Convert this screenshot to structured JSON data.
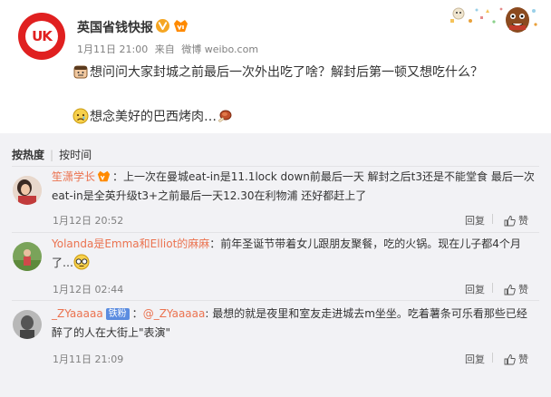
{
  "post": {
    "author": "英国省钱快报",
    "date": "1月11日 21:00",
    "source_prefix": "来自",
    "source": "微博 weibo.com",
    "line1": "想问问大家封城之前最后一次外出吃了啥？解封后第一顿又想吃什么？",
    "line2": "想念美好的巴西烤肉…"
  },
  "tabs": {
    "hot": "按热度",
    "time": "按时间"
  },
  "actions": {
    "reply": "回复",
    "like": "赞"
  },
  "comments": [
    {
      "user": "笙潇学长",
      "text_l1": "：上一次在曼城eat-in是11.1lock down前最后一天 解封之后t3还是不能堂食 最后一次",
      "text_l2": "eat-in是全英升级t3+之前最后一天12.30在利物浦 还好都赶上了",
      "date": "1月12日 20:52"
    },
    {
      "user": "Yolanda是Emma和Elliot的麻麻",
      "text_l1": "：前年圣诞节带着女儿跟朋友聚餐，吃的火锅。现在儿子都4个月",
      "text_l2": "了…",
      "date": "1月12日 02:44"
    },
    {
      "user": "_ZYaaaaa",
      "badge": "铁粉",
      "text_prefix": "：",
      "mention": "@_ZYaaaaa",
      "text_l1": ": 最想的就是夜里和室友走进城去m坐坐。吃着薯条可乐看那些已经",
      "text_l2": "醉了的人在大街上\"表演\"",
      "date": "1月11日 21:09"
    }
  ],
  "colors": {
    "accent": "#eb7350",
    "brand_red": "#e02020",
    "panel_bg": "#f2f2f5",
    "verified_gold": "#f5a623",
    "fans_badge": "#5b8ce0"
  },
  "icons": [
    "uk-logo-avatar",
    "verified-v-icon",
    "vip-badge-icon",
    "face-emoji-icon",
    "sad-emoji-icon",
    "meat-emoji-icon",
    "thumbs-up-icon",
    "glasses-emoji-icon"
  ]
}
